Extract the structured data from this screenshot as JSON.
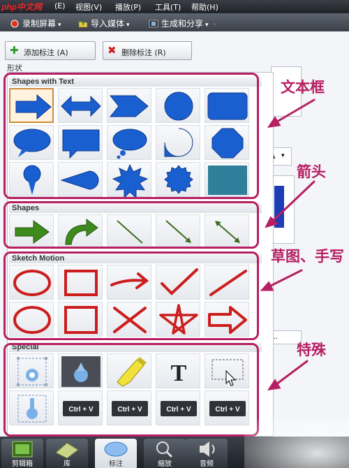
{
  "menubar": {
    "logo": "php中文网",
    "items": [
      "(E)",
      "视图(V)",
      "播放(P)",
      "工具(T)",
      "帮助(H)"
    ]
  },
  "toolbar": {
    "record": "录制屏幕",
    "import": "导入媒体",
    "produce": "生成和分享"
  },
  "buttons": {
    "add": "添加标注 (A)",
    "delete": "删除标注 (R)"
  },
  "shape_label": "形状",
  "sections": [
    {
      "title": "Shapes with Text",
      "annotation": "文本框"
    },
    {
      "title": "Shapes",
      "annotation": "箭头"
    },
    {
      "title": "Sketch Motion",
      "annotation": "草图、手写"
    },
    {
      "title": "Special",
      "annotation": "特殊"
    }
  ],
  "special_labels": {
    "text_tool": "T",
    "keystroke": "Ctrl + V"
  },
  "right_fragments": {
    "font_btn": "A",
    "dots_btn": ")..."
  },
  "bottom_tabs": [
    "剪辑箱",
    "库",
    "标注",
    "缩放",
    "音频"
  ],
  "colors": {
    "accent": "#b61f63",
    "shape_blue": "#1a5fd0",
    "arrow_green": "#3e8a1c",
    "sketch_red": "#cc1d1d"
  }
}
